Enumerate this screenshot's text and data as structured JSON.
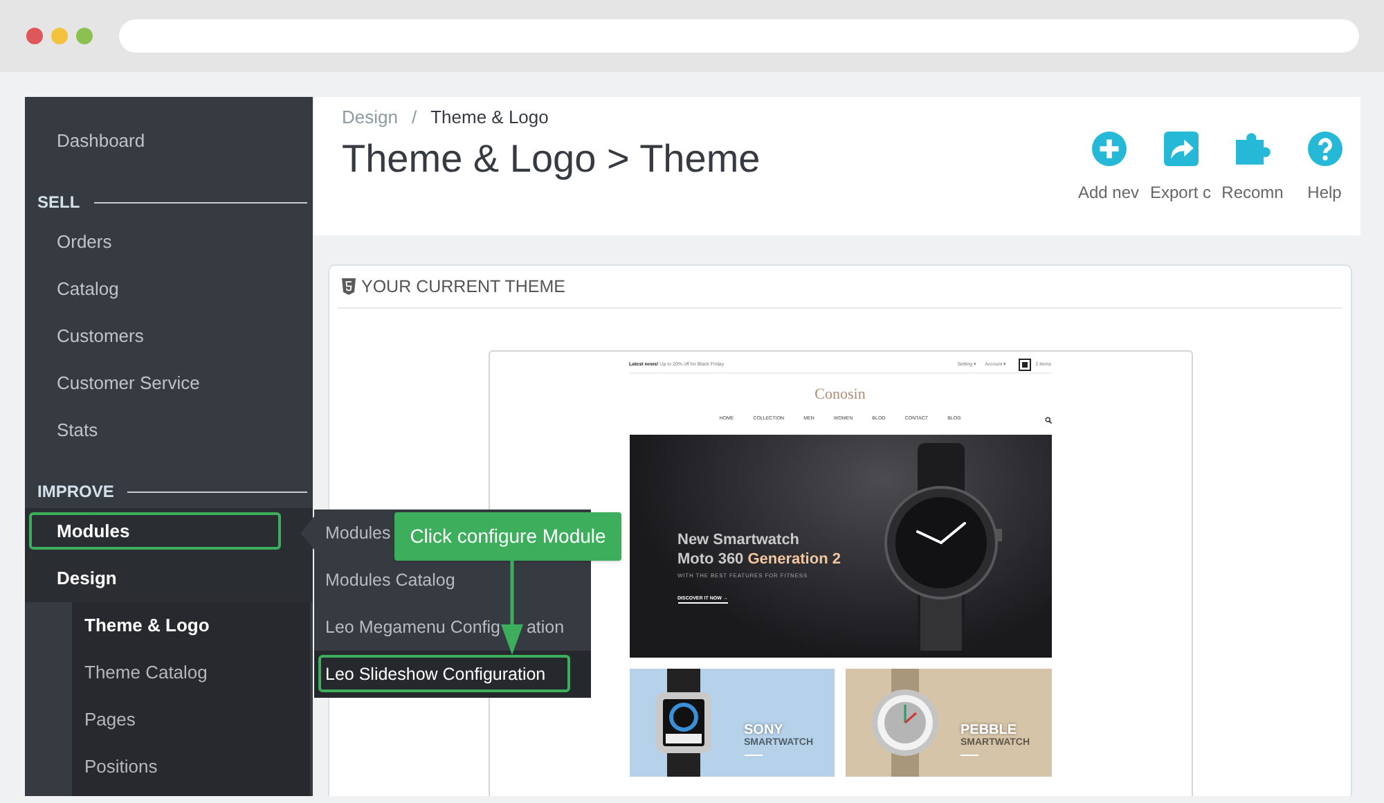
{
  "sidebar": {
    "items": [
      {
        "kind": "link",
        "label": "Dashboard",
        "active": false,
        "outlined": false
      },
      {
        "kind": "heading",
        "label": "SELL"
      },
      {
        "kind": "link",
        "label": "Orders",
        "active": false,
        "outlined": false
      },
      {
        "kind": "link",
        "label": "Catalog",
        "active": false,
        "outlined": false
      },
      {
        "kind": "link",
        "label": "Customers",
        "active": false,
        "outlined": false
      },
      {
        "kind": "link",
        "label": "Customer Service",
        "active": false,
        "outlined": false
      },
      {
        "kind": "link",
        "label": "Stats",
        "active": false,
        "outlined": false
      },
      {
        "kind": "heading",
        "label": "IMPROVE"
      },
      {
        "kind": "link",
        "label": "Modules",
        "active": true,
        "outlined": true
      },
      {
        "kind": "link",
        "label": "Design",
        "active": true,
        "outlined": false,
        "children": [
          {
            "label": "Theme & Logo",
            "selected": true
          },
          {
            "label": "Theme Catalog",
            "selected": false
          },
          {
            "label": "Pages",
            "selected": false
          },
          {
            "label": "Positions",
            "selected": false
          }
        ]
      }
    ]
  },
  "flyout": {
    "items": [
      {
        "label": "Modules",
        "highlighted": false,
        "outlined": false
      },
      {
        "label": "Modules Catalog",
        "highlighted": false,
        "outlined": false
      },
      {
        "label": "Leo Megamenu Config",
        "label_tail": "ation",
        "highlighted": false,
        "outlined": false
      },
      {
        "label": "Leo Slideshow Configuration",
        "highlighted": true,
        "outlined": true
      }
    ]
  },
  "callout": {
    "text": "Click configure Module"
  },
  "header": {
    "breadcrumb": [
      "Design",
      "Theme & Logo"
    ],
    "separator": "/",
    "title": "Theme & Logo > Theme",
    "toolbar": [
      {
        "kind": "add",
        "label": "Add nev"
      },
      {
        "kind": "export",
        "label": "Export c"
      },
      {
        "kind": "modules",
        "label": "Recomn"
      },
      {
        "kind": "help",
        "label": "Help"
      }
    ]
  },
  "panel": {
    "title": "YOUR CURRENT THEME",
    "preview": {
      "announcement": "**Latest news!** Up to 20% off for Black Friday",
      "links": [
        "Setting ▾",
        "Account ▾"
      ],
      "cart": "2 items",
      "logo": "Conosin",
      "nav": [
        "HOME",
        "COLLECTION",
        "MEN",
        "WOMEN",
        "BLOG",
        "CONTACT",
        "BLOG"
      ],
      "slide": {
        "line_1": "New Smartwatch",
        "line_2": "Moto 360 **Generation 2**",
        "tagline": "WITH THE BEST FEATURES FOR FITNESS",
        "link": "DISCOVER IT NOW →"
      },
      "banners": [
        {
          "kind": "square",
          "title": "SONY",
          "subtitle": "SMARTWATCH",
          "color": "#b5d2ea"
        },
        {
          "kind": "round",
          "title": "PEBBLE",
          "subtitle": "SMARTWATCH",
          "color": "#d6c4a8"
        }
      ]
    }
  }
}
